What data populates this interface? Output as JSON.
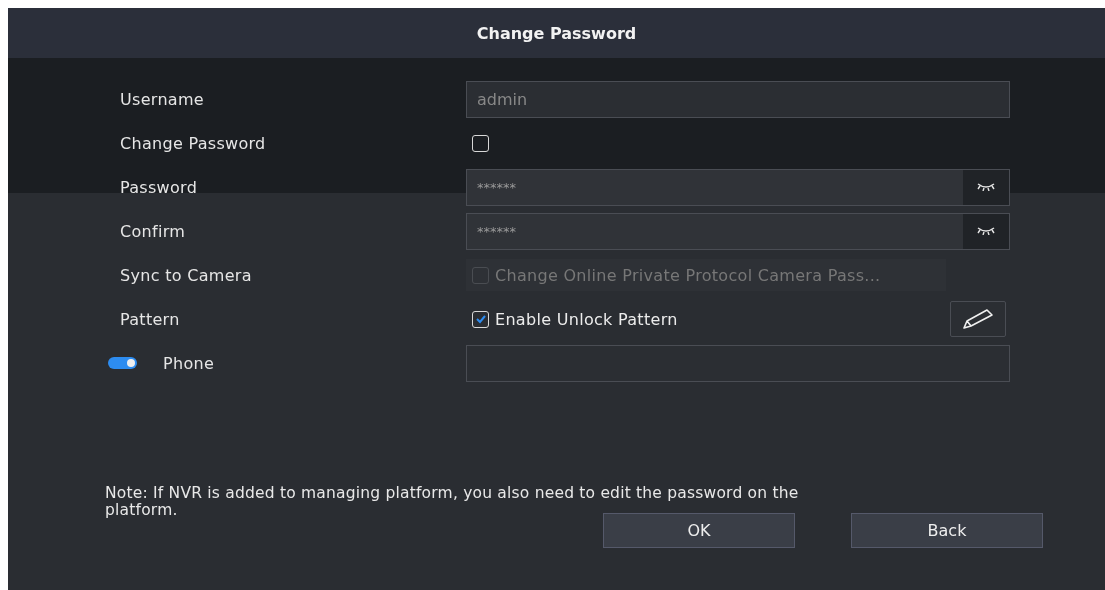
{
  "window": {
    "title": "Change Password"
  },
  "fields": [
    {
      "kind": "text",
      "label": "Username",
      "value": "admin",
      "disabled": true
    },
    {
      "kind": "checkbox",
      "label": "Change Password",
      "checked": false,
      "disabled": false
    },
    {
      "kind": "password",
      "label": "Password",
      "value": "******"
    },
    {
      "kind": "password",
      "label": "Confirm",
      "value": "******"
    },
    {
      "kind": "checkbox",
      "label": "Sync to Camera",
      "checked": false,
      "disabled": true,
      "text": "Change Online Private Protocol Camera Pass..."
    },
    {
      "kind": "pattern",
      "label": "Pattern",
      "checked": true,
      "text": "Enable Unlock Pattern"
    },
    {
      "kind": "phone",
      "label": "Phone",
      "on": true
    }
  ],
  "note": "Note: If NVR is added to managing platform, you also need to edit the password on the platform.",
  "buttons": [
    {
      "label": "OK"
    },
    {
      "label": "Back"
    }
  ]
}
